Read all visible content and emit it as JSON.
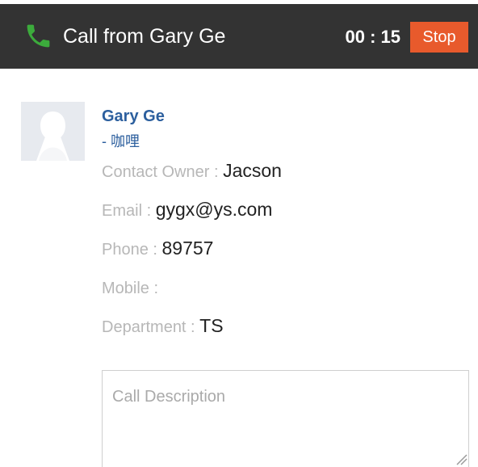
{
  "call": {
    "title": "Call from Gary Ge",
    "timer": "00 : 15",
    "stop_label": "Stop",
    "icon": "phone-icon",
    "icon_color": "#3cab3c",
    "stop_button_color": "#e85a2c"
  },
  "contact": {
    "avatar_icon": "person-placeholder-icon",
    "name": "Gary Ge",
    "note": "- 咖哩",
    "fields": [
      {
        "label": "Contact Owner : ",
        "value": "Jacson"
      },
      {
        "label": "Email : ",
        "value": "gygx@ys.com"
      },
      {
        "label": "Phone : ",
        "value": "89757"
      },
      {
        "label": "Mobile : ",
        "value": ""
      },
      {
        "label": "Department : ",
        "value": "TS"
      }
    ]
  },
  "description": {
    "placeholder": "Call Description",
    "value": ""
  },
  "colors": {
    "header_background": "#333333",
    "link_color": "#2c5f9e",
    "label_color": "#b7b7b7"
  }
}
